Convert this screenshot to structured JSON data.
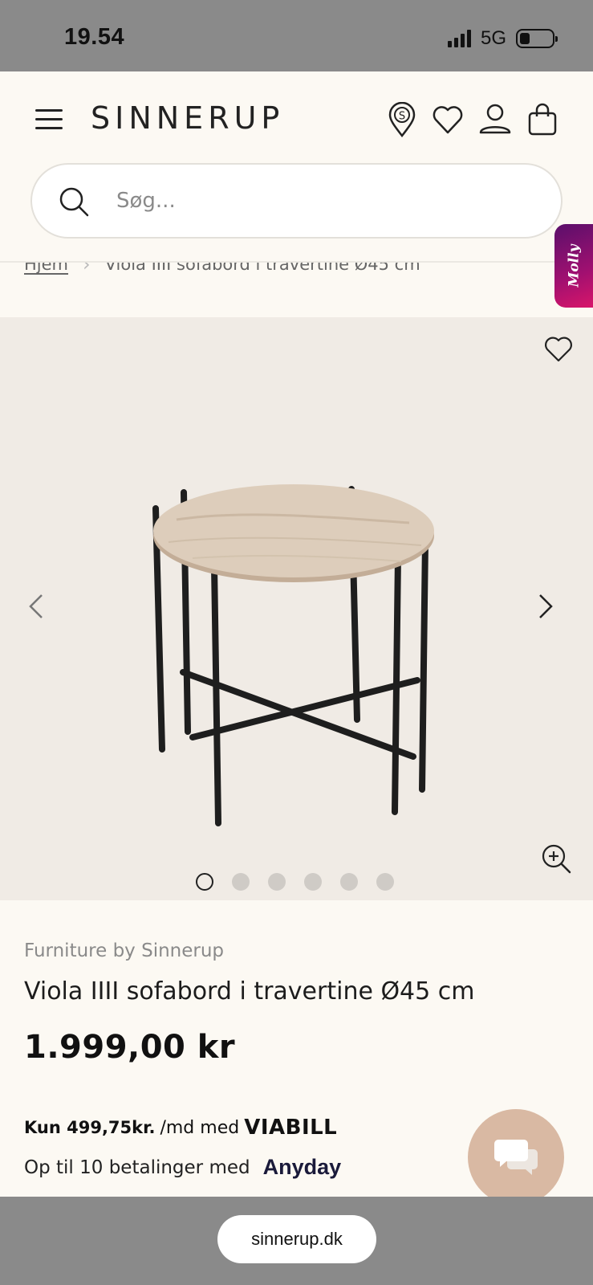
{
  "status_bar": {
    "time": "19.54",
    "network": "5G"
  },
  "header": {
    "logo": "SINNERUP",
    "icons": [
      "menu-icon",
      "store-location-icon",
      "heart-icon",
      "account-icon",
      "cart-icon"
    ]
  },
  "search": {
    "placeholder": "Søg..."
  },
  "breadcrumb": {
    "home": "Hjem",
    "current": "Viola IIII sofabord i travertine Ø45 cm"
  },
  "molly": {
    "label": "Molly"
  },
  "gallery": {
    "image_count": 6,
    "active_index": 0
  },
  "product": {
    "brand": "Furniture by Sinnerup",
    "title": "Viola IIII sofabord i travertine Ø45 cm",
    "price": "1.999,00 kr"
  },
  "financing": {
    "viabill_amount": "Kun 499,75kr.",
    "viabill_text": "/md med",
    "viabill_logo": "VIABILL",
    "anyday_text": "Op til 10 betalinger med",
    "anyday_logo": "Anyday"
  },
  "browser": {
    "url": "sinnerup.dk"
  }
}
